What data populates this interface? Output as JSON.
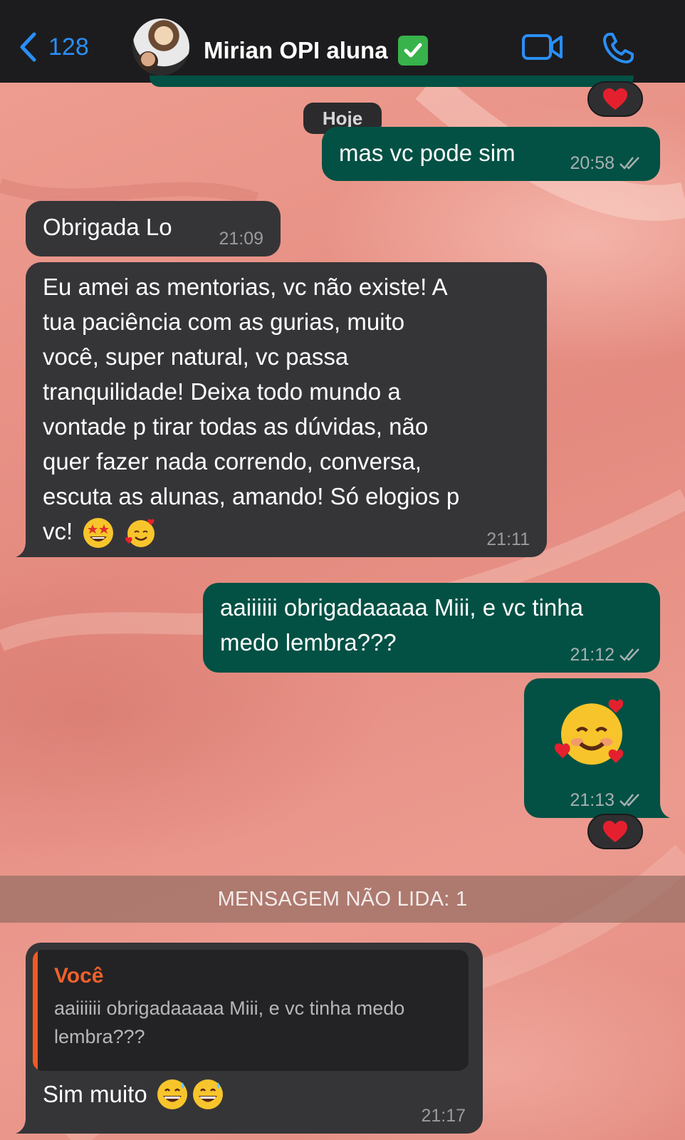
{
  "header": {
    "back_count": "128",
    "contact_name": "Mirian OPI aluna",
    "verified_icon": "check-mark-emoji",
    "video_icon": "video-call-icon",
    "phone_icon": "phone-call-icon",
    "accent_color": "#2a8ff7"
  },
  "chat": {
    "date_separator": "Hoje",
    "unread_banner": "MENSAGEM NÃO LIDA: 1",
    "messages": [
      {
        "direction": "outgoing",
        "text": "mas vc pode sim",
        "time": "20:58",
        "status": "read-double-check"
      },
      {
        "direction": "incoming",
        "text": "Obrigada Lo",
        "time": "21:09"
      },
      {
        "direction": "incoming",
        "lines": [
          "Eu amei as mentorias, vc não existe! A",
          "tua paciência com as gurias, muito",
          "você, super natural, vc passa",
          "tranquilidade! Deixa todo mundo a",
          "vontade p tirar todas as dúvidas, não",
          "quer fazer nada correndo, conversa,",
          "escuta as alunas, amando! Só elogios p",
          "vc!"
        ],
        "emojis": [
          "star-struck-emoji",
          "smiling-face-with-hearts-emoji"
        ],
        "time": "21:11"
      },
      {
        "direction": "outgoing",
        "lines": [
          "aaiiiiii obrigadaaaaa Miii, e vc tinha",
          "medo lembra???"
        ],
        "time": "21:12",
        "status": "read-double-check"
      },
      {
        "direction": "outgoing",
        "emoji": "smiling-face-with-hearts-emoji",
        "time": "21:13",
        "status": "read-double-check",
        "reaction": "red-heart-emoji"
      },
      {
        "direction": "incoming",
        "reply_to": {
          "author": "Você",
          "lines": [
            "aaiiiiii obrigadaaaaa Miii, e vc tinha medo",
            "lembra???"
          ]
        },
        "text": "Sim muito",
        "emojis": [
          "grinning-face-with-sweat-emoji",
          "grinning-face-with-sweat-emoji"
        ],
        "time": "21:17"
      }
    ],
    "colors": {
      "incoming_bubble": "#353538",
      "outgoing_bubble": "#025144",
      "reply_author": "#f0612a"
    }
  }
}
